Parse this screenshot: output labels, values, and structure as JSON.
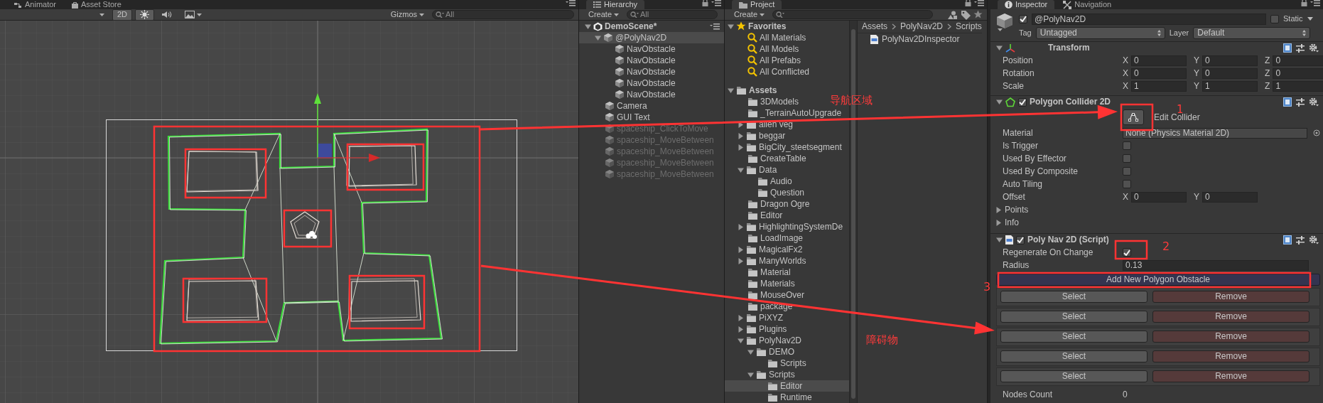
{
  "scene": {
    "tabs": [
      {
        "label": "Animator",
        "kind": "animator",
        "selected": false
      },
      {
        "label": "Asset Store",
        "kind": "store",
        "selected": false
      }
    ],
    "toolbar": {
      "buttons": [
        {
          "kind": "label",
          "label": "2D",
          "on": true
        },
        {
          "kind": "light",
          "on": true
        },
        {
          "kind": "audio",
          "on": false
        },
        {
          "kind": "effects",
          "on": false
        }
      ],
      "gizmos": "Gizmos",
      "search": {
        "placeholder": "All"
      }
    }
  },
  "hierarchy": {
    "title": "Hierarchy",
    "create": "Create",
    "search": {
      "placeholder": "All"
    },
    "scene": {
      "label": "DemoScene*",
      "expanded": true
    },
    "items": [
      {
        "label": "@PolyNav2D",
        "active": true,
        "selected": true,
        "expanded": true,
        "children": [
          {
            "label": "NavObstacle",
            "active": true,
            "selected": false
          },
          {
            "label": "NavObstacle",
            "active": true,
            "selected": false
          },
          {
            "label": "NavObstacle",
            "active": true,
            "selected": false
          },
          {
            "label": "NavObstacle",
            "active": true,
            "selected": false
          },
          {
            "label": "NavObstacle",
            "active": true,
            "selected": false
          }
        ]
      },
      {
        "label": "Camera",
        "active": true,
        "selected": false
      },
      {
        "label": "GUI Text",
        "active": true,
        "selected": false
      },
      {
        "label": "spaceship_ClickToMove",
        "active": false,
        "selected": false
      },
      {
        "label": "spaceship_MoveBetween",
        "active": false,
        "selected": false
      },
      {
        "label": "spaceship_MoveBetween",
        "active": false,
        "selected": false
      },
      {
        "label": "spaceship_MoveBetween",
        "active": false,
        "selected": false
      },
      {
        "label": "spaceship_MoveBetween",
        "active": false,
        "selected": false
      }
    ]
  },
  "project": {
    "title": "Project",
    "create": "Create",
    "favorites": {
      "label": "Favorites",
      "expanded": true,
      "items": [
        {
          "label": "All Materials",
          "selected": false
        },
        {
          "label": "All Models",
          "selected": false
        },
        {
          "label": "All Prefabs",
          "selected": false
        },
        {
          "label": "All Conflicted",
          "selected": false
        }
      ]
    },
    "assets": {
      "label": "Assets",
      "expanded": true,
      "selected": false,
      "children": [
        {
          "label": "3DModels",
          "selected": false
        },
        {
          "label": "_TerrainAutoUpgrade",
          "selected": false
        },
        {
          "label": "alien veg",
          "selected": false,
          "expanded": false
        },
        {
          "label": "beggar",
          "selected": false,
          "expanded": false
        },
        {
          "label": "BigCity_steetsegment",
          "selected": false,
          "expanded": false
        },
        {
          "label": "CreateTable",
          "selected": false
        },
        {
          "label": "Data",
          "selected": false,
          "expanded": true,
          "children": [
            {
              "label": "Audio",
              "selected": false
            },
            {
              "label": "Question",
              "selected": false
            }
          ]
        },
        {
          "label": "Dragon Ogre",
          "selected": false
        },
        {
          "label": "Editor",
          "selected": false
        },
        {
          "label": "HighlightingSystemDe",
          "selected": false,
          "expanded": false
        },
        {
          "label": "LoadImage",
          "selected": false
        },
        {
          "label": "MagicalFx2",
          "selected": false,
          "expanded": false
        },
        {
          "label": "ManyWorlds",
          "selected": false,
          "expanded": false
        },
        {
          "label": "Material",
          "selected": false
        },
        {
          "label": "Materials",
          "selected": false
        },
        {
          "label": "MouseOver",
          "selected": false
        },
        {
          "label": "package",
          "selected": false
        },
        {
          "label": "PiXYZ",
          "selected": false,
          "expanded": false
        },
        {
          "label": "Plugins",
          "selected": false,
          "expanded": false
        },
        {
          "label": "PolyNav2D",
          "selected": false,
          "expanded": true,
          "children": [
            {
              "label": "DEMO",
              "selected": false,
              "expanded": true,
              "children": [
                {
                  "label": "Scripts",
                  "selected": false
                }
              ]
            },
            {
              "label": "Scripts",
              "selected": false,
              "expanded": true,
              "children": [
                {
                  "label": "Editor",
                  "selected": true
                },
                {
                  "label": "Runtime",
                  "selected": false
                }
              ]
            }
          ]
        }
      ]
    },
    "breadcrumb": [
      "Assets",
      "PolyNav2D",
      "Scripts"
    ],
    "files": [
      {
        "label": "PolyNav2DInspector",
        "selected": false
      }
    ]
  },
  "inspector": {
    "tabs": [
      {
        "label": "Inspector",
        "kind": "info",
        "selected": true
      },
      {
        "label": "Navigation",
        "kind": "navigation",
        "selected": false
      }
    ],
    "object": {
      "enabled": true,
      "name": "@PolyNav2D",
      "static_label": "Static",
      "static": false,
      "tag_label": "Tag",
      "tag": "Untagged",
      "layer_label": "Layer",
      "layer": "Default"
    },
    "components": [
      {
        "kind": "transform",
        "title": "Transform",
        "expanded": true,
        "rows": [
          {
            "kind": "vector",
            "label": "Position",
            "fields": [
              {
                "axis": "X",
                "value": "0"
              },
              {
                "axis": "Y",
                "value": "0"
              },
              {
                "axis": "Z",
                "value": "0"
              }
            ]
          },
          {
            "kind": "vector",
            "label": "Rotation",
            "fields": [
              {
                "axis": "X",
                "value": "0"
              },
              {
                "axis": "Y",
                "value": "0"
              },
              {
                "axis": "Z",
                "value": "0"
              }
            ]
          },
          {
            "kind": "vector",
            "label": "Scale",
            "fields": [
              {
                "axis": "X",
                "value": "1"
              },
              {
                "axis": "Y",
                "value": "1"
              },
              {
                "axis": "Z",
                "value": "1"
              }
            ]
          }
        ]
      },
      {
        "kind": "collider",
        "title": "Polygon Collider 2D",
        "enabled": true,
        "expanded": true,
        "rows": [
          {
            "kind": "edit",
            "label": "Edit Collider"
          },
          {
            "kind": "object",
            "label": "Material",
            "value": "None (Physics Material 2D)"
          },
          {
            "kind": "checkbox",
            "label": "Is Trigger",
            "checked": false
          },
          {
            "kind": "checkbox",
            "label": "Used By Effector",
            "checked": false
          },
          {
            "kind": "checkbox",
            "label": "Used By Composite",
            "checked": false
          },
          {
            "kind": "checkbox",
            "label": "Auto Tiling",
            "checked": false
          },
          {
            "kind": "vector",
            "label": "Offset",
            "fields": [
              {
                "axis": "X",
                "value": "0"
              },
              {
                "axis": "Y",
                "value": "0"
              }
            ]
          },
          {
            "kind": "foldout",
            "label": "Points",
            "expanded": false
          },
          {
            "kind": "foldout",
            "label": "Info",
            "expanded": false
          }
        ]
      },
      {
        "kind": "script",
        "title": "Poly Nav 2D (Script)",
        "enabled": true,
        "expanded": true,
        "rows": [
          {
            "kind": "checkbox",
            "label": "Regenerate On Change",
            "checked": true
          },
          {
            "kind": "text",
            "label": "Radius",
            "value": "0.13"
          },
          {
            "kind": "wide_button",
            "label": "Add New Polygon Obstacle"
          },
          {
            "kind": "pair",
            "select": "Select",
            "remove": "Remove"
          },
          {
            "kind": "pair",
            "select": "Select",
            "remove": "Remove"
          },
          {
            "kind": "pair",
            "select": "Select",
            "remove": "Remove"
          },
          {
            "kind": "pair",
            "select": "Select",
            "remove": "Remove"
          },
          {
            "kind": "pair",
            "select": "Select",
            "remove": "Remove"
          },
          {
            "kind": "readout",
            "label": "Nodes Count",
            "value": "0"
          }
        ]
      }
    ]
  },
  "annotations": [
    {
      "kind": "area",
      "text": "导航区域"
    },
    {
      "kind": "obstacle",
      "text": "障碍物"
    },
    {
      "kind": "step1",
      "text": "1"
    },
    {
      "kind": "step2",
      "text": "2"
    },
    {
      "kind": "step3",
      "text": "3"
    }
  ]
}
